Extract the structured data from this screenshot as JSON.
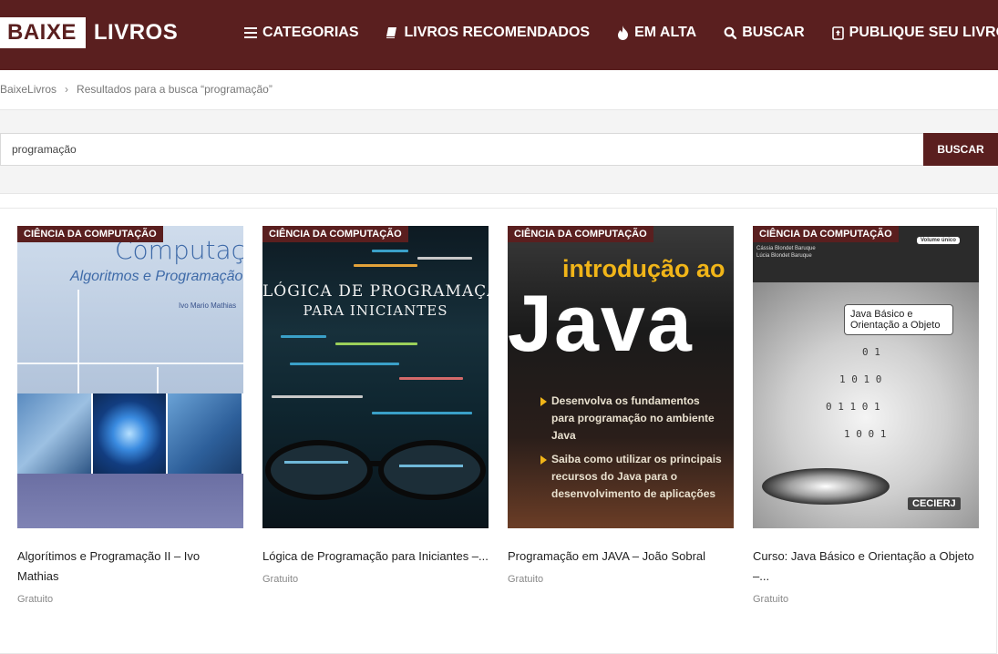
{
  "header": {
    "logo_box": "BAIXE",
    "logo_text": "LIVROS",
    "nav": [
      {
        "label": "CATEGORIAS",
        "icon": "menu-icon"
      },
      {
        "label": "LIVROS RECOMENDADOS",
        "icon": "book-icon"
      },
      {
        "label": "EM ALTA",
        "icon": "fire-icon"
      },
      {
        "label": "BUSCAR",
        "icon": "search-icon"
      },
      {
        "label": "PUBLIQUE SEU LIVRO",
        "icon": "upload-book-icon"
      }
    ]
  },
  "breadcrumb": {
    "home": "BaixeLivros",
    "separator": "›",
    "current": "Resultados para a busca “programação”"
  },
  "search": {
    "value": "programação",
    "button": "BUSCAR"
  },
  "results": [
    {
      "category": "CIÊNCIA DA COMPUTAÇÃO",
      "title": "Algorítimos e Programação II – Ivo Mathias",
      "price": "Gratuito",
      "cover": {
        "line1": "Computação",
        "line2": "Algoritmos e Programação II",
        "line3": "Ivo Mario Mathias"
      }
    },
    {
      "category": "CIÊNCIA DA COMPUTAÇÃO",
      "title": "Lógica de Programação para Iniciantes –...",
      "price": "Gratuito",
      "cover": {
        "line1": "LÓGICA DE PROGRAMAÇÃO",
        "line2": "PARA INICIANTES"
      }
    },
    {
      "category": "CIÊNCIA DA COMPUTAÇÃO",
      "title": "Programação em JAVA – João Sobral",
      "price": "Gratuito",
      "cover": {
        "line1": "introdução ao",
        "line2": "Java",
        "bullet1": "Desenvolva os fundamentos para programação no ambiente Java",
        "bullet2": "Saiba como utilizar os principais recursos do Java para o desenvolvimento de aplicações"
      }
    },
    {
      "category": "CIÊNCIA DA COMPUTAÇÃO",
      "title": "Curso: Java Básico e Orientação a Objeto –...",
      "price": "Gratuito",
      "cover": {
        "author1": "Cássia Blondet Baruque",
        "author2": "Lúcia Blondet Baruque",
        "volume": "Volume único",
        "label": "Java Básico e Orientação a Objeto",
        "brand": "CECIERJ"
      }
    }
  ],
  "colors": {
    "brand": "#5a1f1f",
    "badge": "#5a1f1f",
    "java_accent": "#f1b518"
  }
}
